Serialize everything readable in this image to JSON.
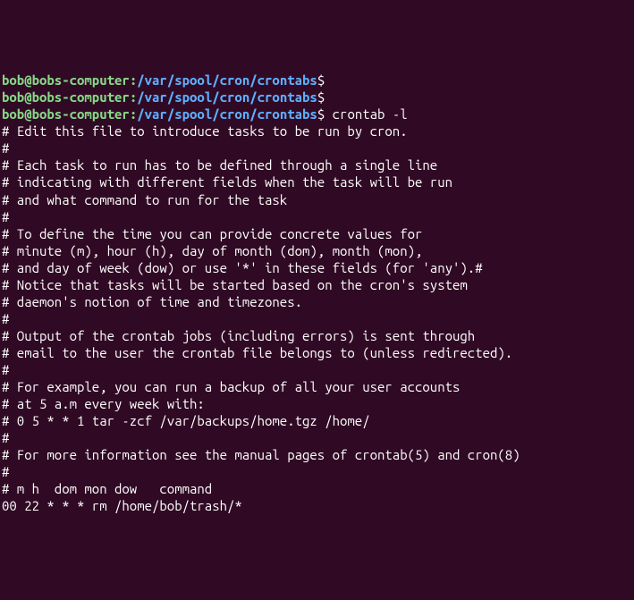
{
  "prompt": {
    "user_host": "bob@bobs-computer",
    "path": "/var/spool/cron/crontabs",
    "dollar": "$"
  },
  "commands": {
    "empty1": "",
    "empty2": "",
    "crontab": "crontab -l"
  },
  "output_lines": {
    "l0": "# Edit this file to introduce tasks to be run by cron.",
    "l1": "#",
    "l2": "# Each task to run has to be defined through a single line",
    "l3": "# indicating with different fields when the task will be run",
    "l4": "# and what command to run for the task",
    "l5": "#",
    "l6": "# To define the time you can provide concrete values for",
    "l7": "# minute (m), hour (h), day of month (dom), month (mon),",
    "l8": "# and day of week (dow) or use '*' in these fields (for 'any').#",
    "l9": "# Notice that tasks will be started based on the cron's system",
    "l10": "# daemon's notion of time and timezones.",
    "l11": "#",
    "l12": "# Output of the crontab jobs (including errors) is sent through",
    "l13": "# email to the user the crontab file belongs to (unless redirected).",
    "l14": "#",
    "l15": "# For example, you can run a backup of all your user accounts",
    "l16": "# at 5 a.m every week with:",
    "l17": "# 0 5 * * 1 tar -zcf /var/backups/home.tgz /home/",
    "l18": "#",
    "l19": "# For more information see the manual pages of crontab(5) and cron(8)",
    "l20": "#",
    "l21": "# m h  dom mon dow   command",
    "l22": "",
    "l23": "00 22 * * * rm /home/bob/trash/*"
  }
}
